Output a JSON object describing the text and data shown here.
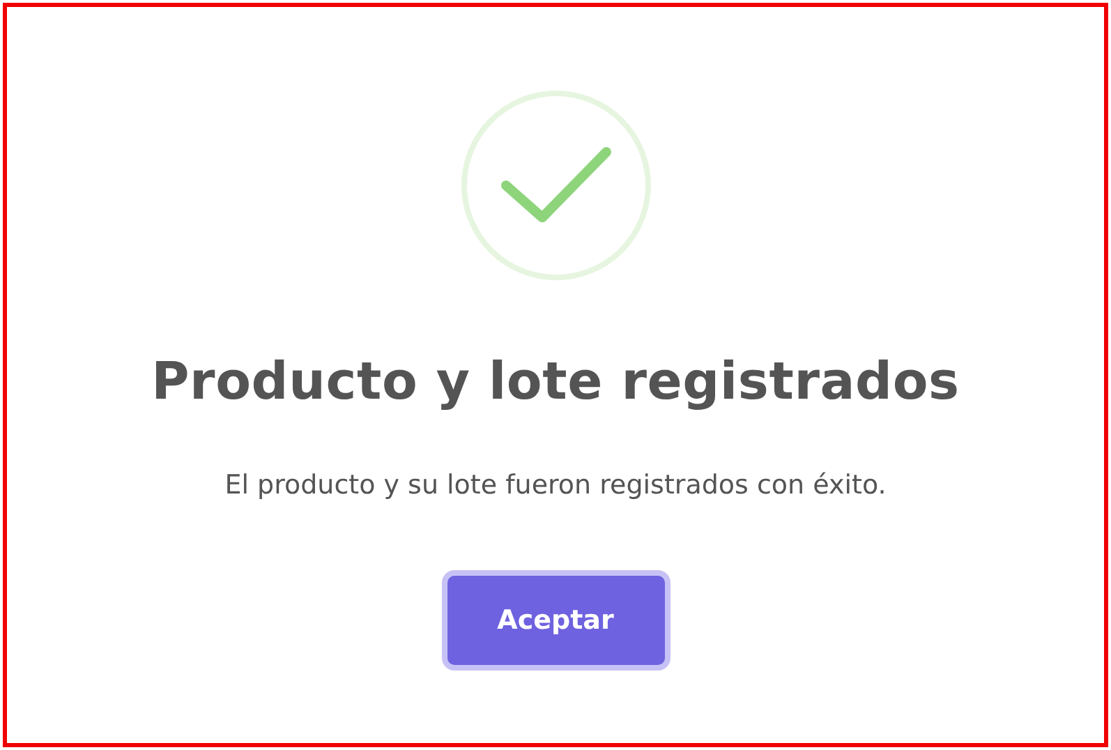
{
  "dialog": {
    "icon": {
      "kind": "success"
    },
    "title": "Producto y lote registrados",
    "message": "El producto y su lote fueron registrados con éxito.",
    "buttons": [
      {
        "label": "Aceptar",
        "focused": true
      }
    ]
  }
}
